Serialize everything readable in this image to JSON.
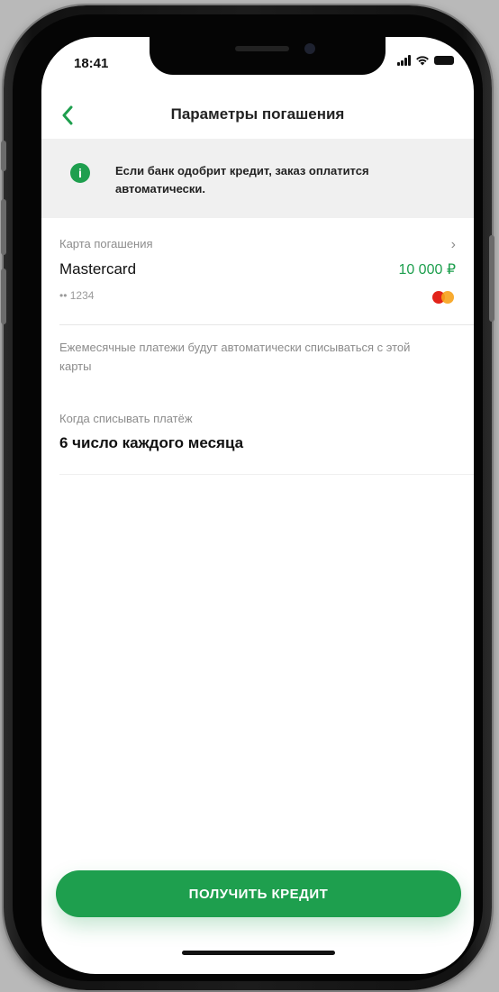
{
  "status_bar": {
    "time": "18:41"
  },
  "header": {
    "title": "Параметры погашения"
  },
  "info_banner": {
    "text": "Если банк одобрит кредит, заказ оплатится автоматически."
  },
  "repayment_card": {
    "caption": "Карта погашения",
    "name": "Mastercard",
    "amount": "10 000 ₽",
    "number": "•• 1234"
  },
  "note": {
    "text": "Ежемесячные платежи будут автоматически списываться с этой карты"
  },
  "payment_date": {
    "caption": "Когда списывать платёж",
    "value": "6 число каждого месяца"
  },
  "cta": {
    "label": "ПОЛУЧИТЬ КРЕДИТ"
  },
  "colors": {
    "accent": "#1e9f4e",
    "mastercard_red": "#e2231a",
    "mastercard_yellow": "#f7a21b"
  },
  "icons": [
    "back-arrow-icon",
    "info-icon",
    "chevron-right-icon",
    "mastercard-icon",
    "signal-icon",
    "wifi-icon",
    "battery-icon"
  ]
}
